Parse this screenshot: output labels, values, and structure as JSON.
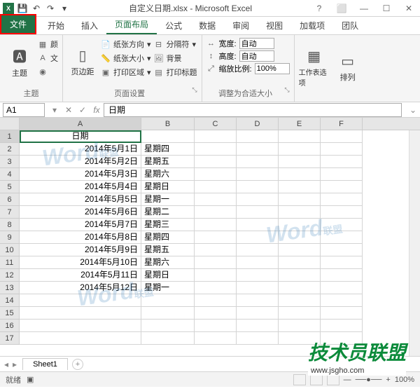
{
  "titlebar": {
    "title": "自定义日期.xlsx - Microsoft Excel",
    "help_icon": "?",
    "ribbon_opts_icon": "▾"
  },
  "tabs": {
    "file": "文件",
    "home": "开始",
    "insert": "插入",
    "page_layout": "页面布局",
    "formulas": "公式",
    "data": "数据",
    "review": "审阅",
    "view": "视图",
    "addins": "加载项",
    "team": "团队"
  },
  "ribbon": {
    "themes": {
      "label": "主题",
      "theme_btn": "主题",
      "colors": "颜",
      "fonts": "文",
      "effects": "◉"
    },
    "page_setup": {
      "label": "页面设置",
      "margins": "页边距",
      "orientation": "纸张方向",
      "size": "纸张大小",
      "print_area": "打印区域",
      "breaks": "分隔符",
      "background": "背景",
      "print_titles": "打印标题"
    },
    "scale": {
      "label": "调整为合适大小",
      "width_lbl": "宽度:",
      "width_val": "自动",
      "height_lbl": "高度:",
      "height_val": "自动",
      "scale_lbl": "缩放比例:",
      "scale_val": "100%"
    },
    "sheet_options": {
      "label": "",
      "sheet_opts": "工作表选项",
      "arrange": "排列"
    }
  },
  "namebox": "A1",
  "formula_bar": "日期",
  "columns": [
    "A",
    "B",
    "C",
    "D",
    "E",
    "F"
  ],
  "rows": [
    {
      "n": 1,
      "a": "日期",
      "b": ""
    },
    {
      "n": 2,
      "a": "2014年5月1日",
      "b": "星期四"
    },
    {
      "n": 3,
      "a": "2014年5月2日",
      "b": "星期五"
    },
    {
      "n": 4,
      "a": "2014年5月3日",
      "b": "星期六"
    },
    {
      "n": 5,
      "a": "2014年5月4日",
      "b": "星期日"
    },
    {
      "n": 6,
      "a": "2014年5月5日",
      "b": "星期一"
    },
    {
      "n": 7,
      "a": "2014年5月6日",
      "b": "星期二"
    },
    {
      "n": 8,
      "a": "2014年5月7日",
      "b": "星期三"
    },
    {
      "n": 9,
      "a": "2014年5月8日",
      "b": "星期四"
    },
    {
      "n": 10,
      "a": "2014年5月9日",
      "b": "星期五"
    },
    {
      "n": 11,
      "a": "2014年5月10日",
      "b": "星期六"
    },
    {
      "n": 12,
      "a": "2014年5月11日",
      "b": "星期日"
    },
    {
      "n": 13,
      "a": "2014年5月12日",
      "b": "星期一"
    },
    {
      "n": 14,
      "a": "",
      "b": ""
    },
    {
      "n": 15,
      "a": "",
      "b": ""
    },
    {
      "n": 16,
      "a": "",
      "b": ""
    },
    {
      "n": 17,
      "a": "",
      "b": ""
    }
  ],
  "sheet": {
    "name": "Sheet1"
  },
  "statusbar": {
    "ready": "就绪",
    "zoom": "100%"
  },
  "watermark": {
    "text": "Word",
    "suffix": "联盟"
  },
  "brand": {
    "text": "技术员联盟",
    "url": "www.jsgho.com"
  }
}
